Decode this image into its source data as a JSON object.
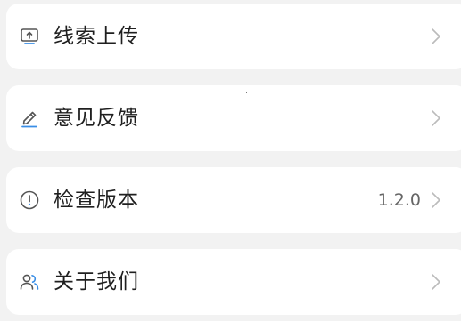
{
  "menu": {
    "items": [
      {
        "label": "线索上传",
        "icon": "upload-screen-icon"
      },
      {
        "label": "意见反馈",
        "icon": "pencil-edit-icon"
      },
      {
        "label": "检查版本",
        "icon": "exclamation-circle-icon",
        "value": "1.2.0"
      },
      {
        "label": "关于我们",
        "icon": "users-icon"
      }
    ]
  },
  "colors": {
    "background": "#f2f2f2",
    "card": "#ffffff",
    "text": "#1f1f1f",
    "accent_icon": "#3a8ee6",
    "icon_gray": "#555555",
    "chevron": "#bbbbbb",
    "value_text": "#666666"
  }
}
